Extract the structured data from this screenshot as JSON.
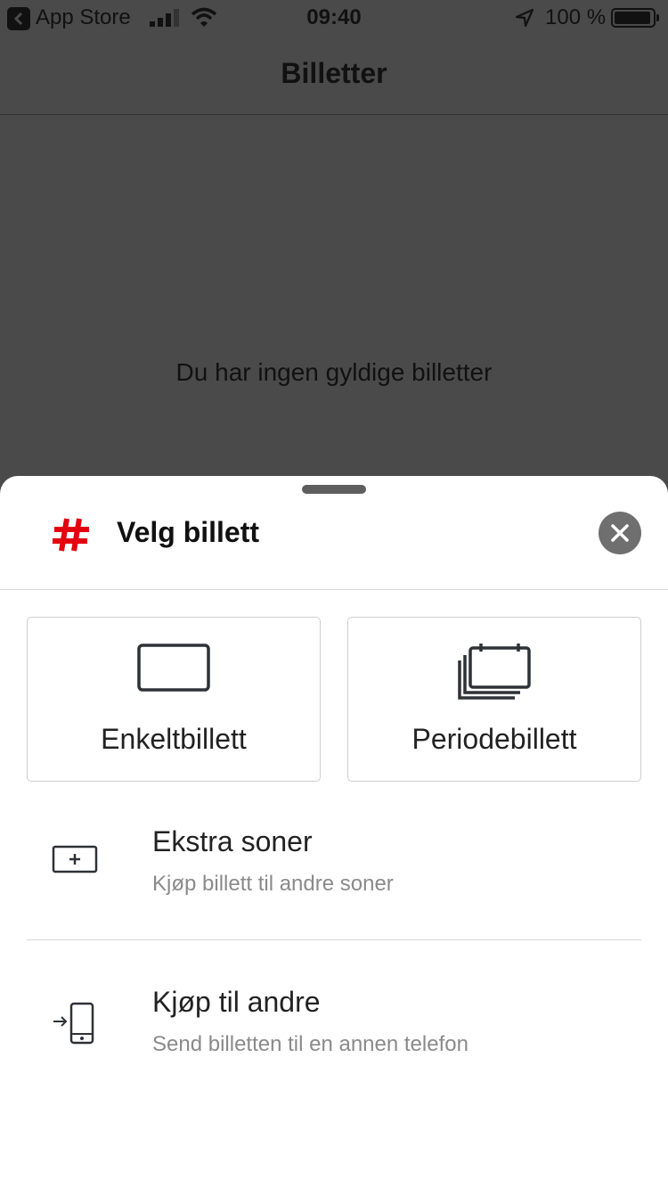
{
  "status_bar": {
    "back_app": "App Store",
    "time": "09:40",
    "battery": "100 %"
  },
  "background": {
    "nav_title": "Billetter",
    "empty_message": "Du har ingen gyldige billetter"
  },
  "sheet": {
    "title": "Velg billett",
    "brand_color": "#e3000f",
    "options": [
      {
        "label": "Enkeltbillett",
        "icon": "single-ticket-icon"
      },
      {
        "label": "Periodebillett",
        "icon": "period-ticket-icon"
      }
    ],
    "list": [
      {
        "title": "Ekstra soner",
        "subtitle": "Kjøp billett til andre soner",
        "icon": "add-zone-icon"
      },
      {
        "title": "Kjøp til andre",
        "subtitle": "Send billetten til en annen telefon",
        "icon": "send-to-phone-icon"
      }
    ]
  }
}
